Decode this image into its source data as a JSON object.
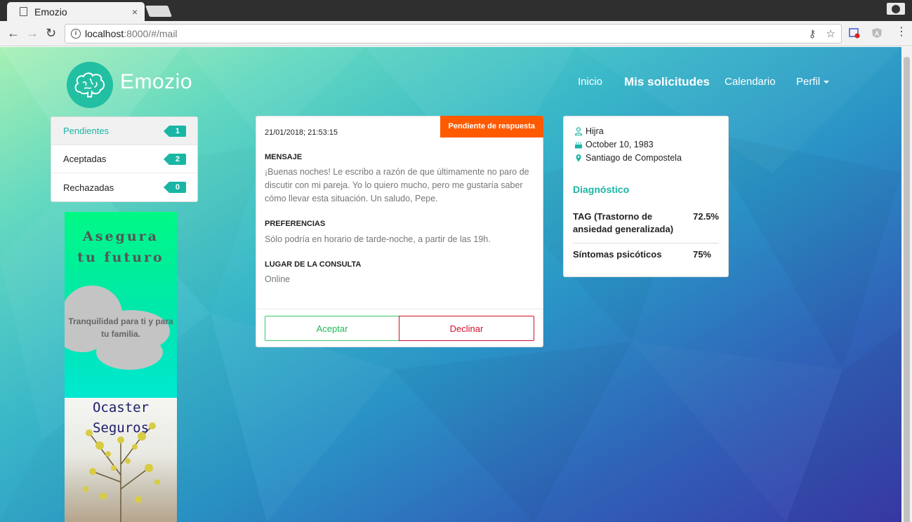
{
  "browser": {
    "tab_title": "Emozio",
    "tab_close": "×",
    "url_host": "localhost",
    "url_rest": ":8000/#/mail"
  },
  "header": {
    "brand": "Emozio",
    "nav": {
      "inicio": "Inicio",
      "solicitudes": "Mis solicitudes",
      "calendario": "Calendario",
      "perfil": "Perfil"
    }
  },
  "folders": [
    {
      "label": "Pendientes",
      "count": "1"
    },
    {
      "label": "Aceptadas",
      "count": "2"
    },
    {
      "label": "Rechazadas",
      "count": "0"
    }
  ],
  "ad": {
    "title_line1": "Asegura",
    "title_line2": "tu futuro",
    "tagline": "Tranquilidad para ti y para tu familia.",
    "brand_line1": "Ocaster",
    "brand_line2": "Seguros"
  },
  "message": {
    "status": "Pendiente de respuesta",
    "date": "21/01/2018; 21:53:15",
    "mensaje_title": "MENSAJE",
    "mensaje_text": "¡Buenas noches! Le escribo a razón de que últimamente no paro de discutir con mi pareja. Yo lo quiero mucho, pero me gustaría saber cómo llevar esta situación. Un saludo, Pepe.",
    "preferencias_title": "PREFERENCIAS",
    "preferencias_text": "Sólo podría en horario de tarde-noche, a partir de las 19h.",
    "lugar_title": "LUGAR DE LA CONSULTA",
    "lugar_text": "Online",
    "accept_label": "Aceptar",
    "decline_label": "Declinar"
  },
  "patient": {
    "name": "Hijra",
    "birthdate": "October 10, 1983",
    "location": "Santiago de Compostela",
    "diagnosis_title": "Diagnóstico",
    "diagnoses": [
      {
        "label": "TAG (Trastorno de ansiedad generalizada)",
        "value": "72.5%"
      },
      {
        "label": "Síntomas psicóticos",
        "value": "75%"
      }
    ]
  },
  "colors": {
    "accent": "#19b6a4",
    "status_orange": "#ff5a00",
    "accept_green": "#22b858",
    "decline_red": "#d0102a"
  }
}
